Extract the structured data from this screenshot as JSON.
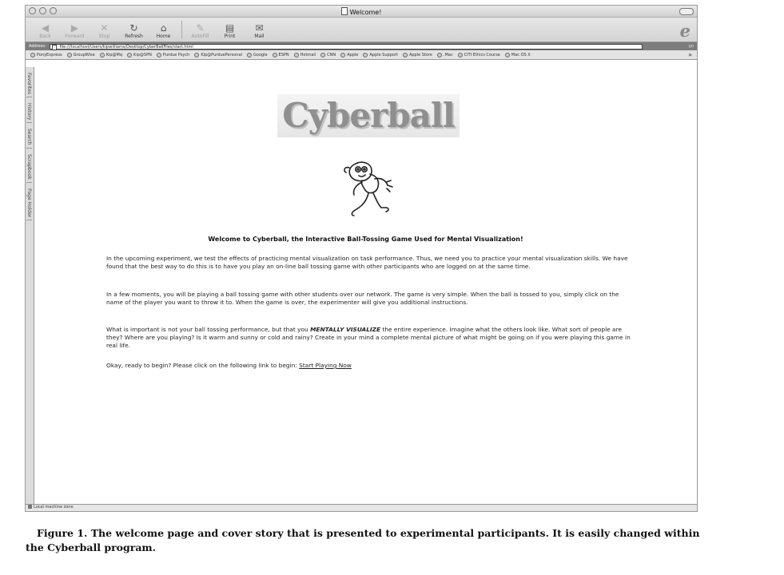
{
  "window": {
    "title": "Welcome!"
  },
  "toolbar": {
    "buttons": [
      {
        "label": "Back",
        "icon": "back-arrow-icon",
        "glyph": "◀",
        "enabled": false
      },
      {
        "label": "Forward",
        "icon": "forward-arrow-icon",
        "glyph": "▶",
        "enabled": false
      },
      {
        "label": "Stop",
        "icon": "stop-icon",
        "glyph": "✕",
        "enabled": false
      },
      {
        "label": "Refresh",
        "icon": "refresh-icon",
        "glyph": "↻",
        "enabled": true
      },
      {
        "label": "Home",
        "icon": "home-icon",
        "glyph": "⌂",
        "enabled": true
      },
      {
        "label": "AutoFill",
        "icon": "autofill-icon",
        "glyph": "✎",
        "enabled": false
      },
      {
        "label": "Print",
        "icon": "print-icon",
        "glyph": "▤",
        "enabled": true
      },
      {
        "label": "Mail",
        "icon": "mail-icon",
        "glyph": "✉",
        "enabled": true
      }
    ],
    "logo_glyph": "e"
  },
  "address": {
    "label": "Address:",
    "url": "file:///localhost/Users/kipwilliams/Desktop/CyberBallFiles/start.html",
    "go": "go"
  },
  "favorites": [
    "PonyExpress",
    "GroupWise",
    "Kip@Mq",
    "Kip@SPN",
    "Purdue Psych",
    "Kip@PurduePersonal",
    "Google",
    "ESPN",
    "Hotmail",
    "CNN",
    "Apple",
    "Apple Support",
    "Apple Store",
    ".Mac",
    "CITI Ethics Course",
    "Mac OS X"
  ],
  "favorites_more": "»",
  "sidebar_tabs": [
    "Favorites",
    "History",
    "Search",
    "Scrapbook",
    "Page Holder"
  ],
  "page": {
    "logo_text": "Cyberball",
    "heading": "Welcome to Cyberball, the Interactive Ball-Tossing Game Used for Mental Visualization!",
    "paragraph1": "In the upcoming experiment, we test the effects of practicing mental visualization on task performance. Thus, we need you to practice your mental visualization skills. We have found that the best way to do this is to have you play an on-line ball tossing game with other participants who are logged on at the same time.",
    "paragraph2": "In a few moments, you will be playing a ball tossing game with other students over our network.  The game is very simple.  When the ball is tossed to you, simply click on the name of the player you want to throw it to.  When the game is over, the experimenter will give you additional instructions.",
    "paragraph3_before": "What is important is not your ball tossing performance, but that you ",
    "paragraph3_emph": "MENTALLY VISUALIZE",
    "paragraph3_after": " the entire experience. Imagine what the others look like. What sort of people are they? Where are you playing? Is it warm and sunny or cold and rainy? Create in your mind a complete mental picture of what might be going on if you were playing this game in real life.",
    "paragraph4": "Okay, ready to begin? Please click on the following link to begin:  ",
    "start_link": "Start Playing Now"
  },
  "status": {
    "text": "Local machine zone"
  },
  "caption": "Figure 1. The welcome page and cover story that is presented to experimental participants. It is easily changed within the Cyberball program."
}
